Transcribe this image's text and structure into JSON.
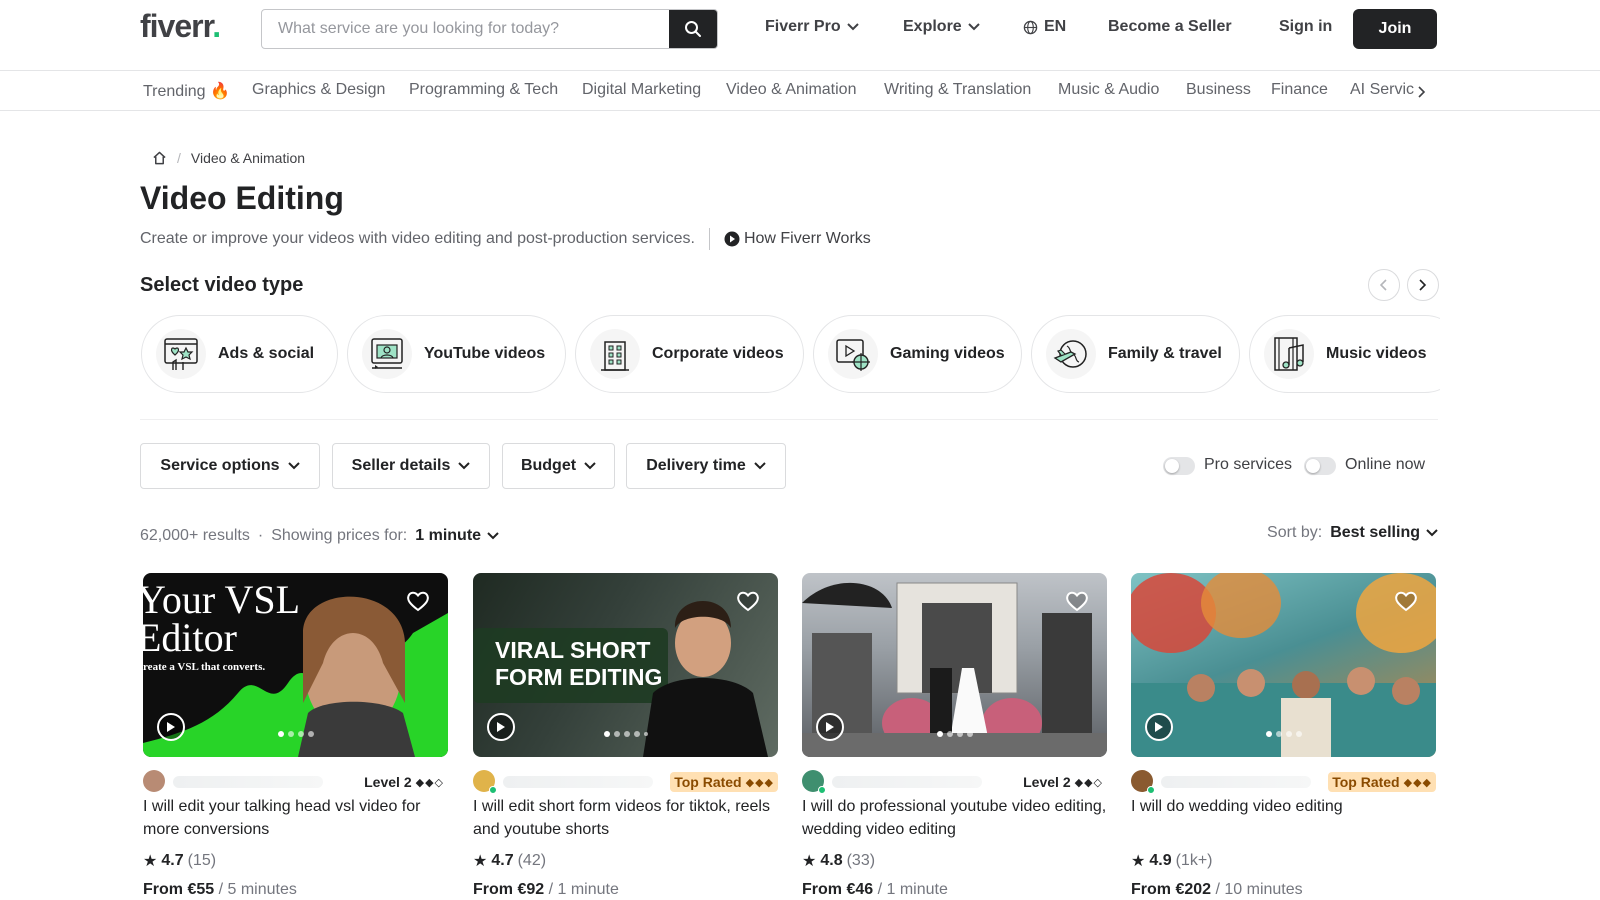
{
  "header": {
    "logo": "fiverr",
    "logo_dot": ".",
    "search_placeholder": "What service are you looking for today?",
    "nav": [
      "Fiverr Pro",
      "Explore",
      "EN",
      "Become a Seller",
      "Sign in"
    ],
    "join": "Join"
  },
  "categories": [
    "Trending 🔥",
    "Graphics & Design",
    "Programming & Tech",
    "Digital Marketing",
    "Video & Animation",
    "Writing & Translation",
    "Music & Audio",
    "Business",
    "Finance",
    "AI Servic"
  ],
  "breadcrumb": {
    "sep": "/",
    "current": "Video & Animation"
  },
  "page": {
    "title": "Video Editing",
    "subtitle": "Create or improve your videos with video editing and post-production services.",
    "how_works": "How Fiverr Works",
    "select_type": "Select video type"
  },
  "video_types": [
    "Ads & social",
    "YouTube videos",
    "Corporate videos",
    "Gaming videos",
    "Family & travel",
    "Music videos"
  ],
  "filters": [
    "Service options",
    "Seller details",
    "Budget",
    "Delivery time"
  ],
  "toggles": [
    "Pro services",
    "Online now"
  ],
  "results": {
    "count": "62,000+ results",
    "bullet": "·",
    "showing": "Showing prices for:",
    "unit": "1 minute",
    "sort_label": "Sort by:",
    "sort_value": "Best selling"
  },
  "gigs": [
    {
      "level": "Level 2",
      "diamonds": "◆◆◇",
      "title": "I will edit your talking head vsl video for more conversions",
      "rating": "4.7",
      "reviews": "(15)",
      "price": "From €55",
      "per": " / 5 minutes",
      "overlay1": "Your VSL",
      "overlay2": "Editor",
      "overlay3": "reate a VSL that converts."
    },
    {
      "level": "Top Rated",
      "diamonds": "◆◆◆",
      "title": "I will edit short form videos for tiktok, reels and youtube shorts",
      "rating": "4.7",
      "reviews": "(42)",
      "price": "From €92",
      "per": " / 1 minute",
      "overlay1": "VIRAL SHORT",
      "overlay2": "FORM EDITING",
      "overlay3": ""
    },
    {
      "level": "Level 2",
      "diamonds": "◆◆◇",
      "title": "I will do professional youtube video editing, wedding video editing",
      "rating": "4.8",
      "reviews": "(33)",
      "price": "From €46",
      "per": " / 1 minute",
      "overlay1": "",
      "overlay2": "",
      "overlay3": ""
    },
    {
      "level": "Top Rated",
      "diamonds": "◆◆◆",
      "title": "I will do wedding video editing",
      "rating": "4.9",
      "reviews": "(1k+)",
      "price": "From €202",
      "per": " / 10 minutes",
      "overlay1": "",
      "overlay2": "",
      "overlay3": ""
    }
  ],
  "colors": {
    "brand": "#1dbf73",
    "dark": "#222325",
    "top_rated_bg": "#ffe0b3"
  }
}
